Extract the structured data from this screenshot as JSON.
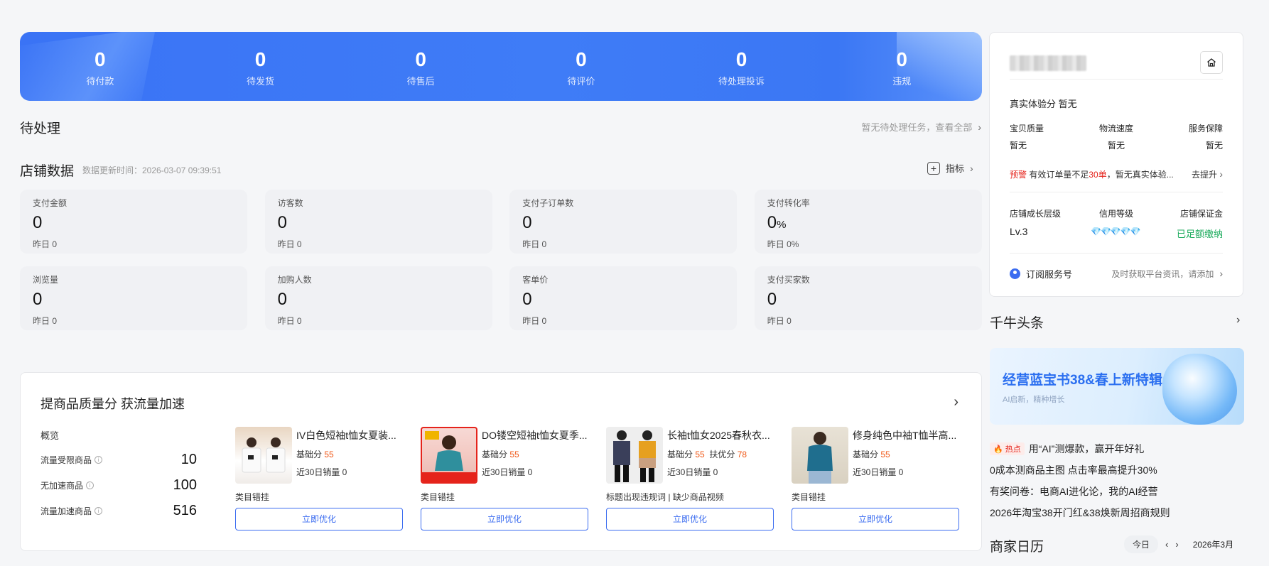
{
  "banner": {
    "stats": [
      {
        "value": "0",
        "label": "待付款"
      },
      {
        "value": "0",
        "label": "待发货"
      },
      {
        "value": "0",
        "label": "待售后"
      },
      {
        "value": "0",
        "label": "待评价"
      },
      {
        "value": "0",
        "label": "待处理投诉"
      },
      {
        "value": "0",
        "label": "违规"
      }
    ]
  },
  "pending": {
    "title": "待处理",
    "link": "暂无待处理任务，查看全部"
  },
  "store_data": {
    "title": "店铺数据",
    "updated": "数据更新时间：2026-03-07 09:39:51",
    "metric_button": "指标",
    "cards": [
      {
        "title": "支付金额",
        "value": "0",
        "unit": "",
        "yesterday": "昨日 0"
      },
      {
        "title": "访客数",
        "value": "0",
        "unit": "",
        "yesterday": "昨日 0"
      },
      {
        "title": "支付子订单数",
        "value": "0",
        "unit": "",
        "yesterday": "昨日 0"
      },
      {
        "title": "支付转化率",
        "value": "0",
        "unit": "%",
        "yesterday": "昨日 0%"
      },
      {
        "title": "浏览量",
        "value": "0",
        "unit": "",
        "yesterday": "昨日 0"
      },
      {
        "title": "加购人数",
        "value": "0",
        "unit": "",
        "yesterday": "昨日 0"
      },
      {
        "title": "客单价",
        "value": "0",
        "unit": "",
        "yesterday": "昨日 0"
      },
      {
        "title": "支付买家数",
        "value": "0",
        "unit": "",
        "yesterday": "昨日 0"
      }
    ]
  },
  "quality": {
    "title": "提商品质量分 获流量加速",
    "overview": {
      "heading": "概览",
      "rows": [
        {
          "label": "流量受限商品",
          "value": "10"
        },
        {
          "label": "无加速商品",
          "value": "100"
        },
        {
          "label": "流量加速商品",
          "value": "516"
        }
      ]
    },
    "products": [
      {
        "name": "IV白色短袖t恤女夏装...",
        "score_label": "基础分",
        "score": "55",
        "extra_label": "",
        "extra": "",
        "sales": "近30日销量 0",
        "issue": "类目错挂",
        "button": "立即优化"
      },
      {
        "name": "DO镂空短袖t恤女夏季...",
        "score_label": "基础分",
        "score": "55",
        "extra_label": "",
        "extra": "",
        "sales": "近30日销量 0",
        "issue": "类目错挂",
        "button": "立即优化"
      },
      {
        "name": "长袖t恤女2025春秋衣...",
        "score_label": "基础分",
        "score": "55",
        "extra_label": "扶优分",
        "extra": "78",
        "sales": "近30日销量 0",
        "issue": "标题出现违规词 | 缺少商品视频",
        "button": "立即优化"
      },
      {
        "name": "修身纯色中袖T恤半高...",
        "score_label": "基础分",
        "score": "55",
        "extra_label": "",
        "extra": "",
        "sales": "近30日销量 0",
        "issue": "类目错挂",
        "button": "立即优化"
      }
    ]
  },
  "right_card": {
    "experience": "真实体验分  暂无",
    "metrics": [
      {
        "label": "宝贝质量",
        "value": "暂无"
      },
      {
        "label": "物流速度",
        "value": "暂无"
      },
      {
        "label": "服务保障",
        "value": "暂无"
      }
    ],
    "warning": {
      "tag": "预警",
      "text_a": "有效订单量不足",
      "highlight": "30单",
      "text_b": "，暂无真实体验...",
      "link": "去提升"
    },
    "growth": {
      "level_label": "店铺成长层级",
      "credit_label": "信用等级",
      "deposit_label": "店铺保证金",
      "level": "Lv.3",
      "credit_diamonds": "💎💎💎💎💎",
      "deposit": "已足额缴纳"
    },
    "subscribe": {
      "label": "订阅服务号",
      "hint": "及时获取平台资讯，请添加"
    }
  },
  "news": {
    "title": "千牛头条",
    "banner_title": "经营蓝宝书38&春上新特辑",
    "banner_sub": "AI启新，精种增长",
    "hot_tag": "热点",
    "items": [
      "用“AI”测爆款，赢开年好礼",
      "0成本测商品主图 点击率最高提升30%",
      "有奖问卷：电商AI进化论，我的AI经营",
      "2026年淘宝38开门红&38焕新周招商规则"
    ]
  },
  "calendar": {
    "title": "商家日历",
    "today": "今日",
    "month": "2026年3月"
  },
  "colors": {
    "accent": "#3b6cf0",
    "warning": "#e5231b",
    "score": "#f05a1a",
    "success": "#1aaa5b"
  }
}
